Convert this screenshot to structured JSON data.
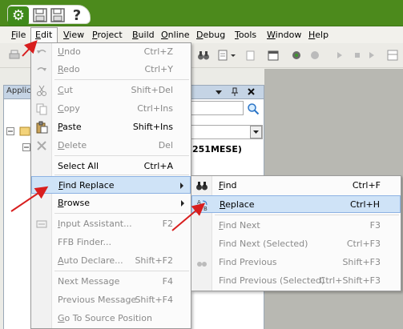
{
  "title_bar": {
    "help_glyph": "?"
  },
  "menubar": {
    "items": [
      {
        "label_pre": "",
        "acc": "F",
        "label_post": "ile"
      },
      {
        "label_pre": "",
        "acc": "E",
        "label_post": "dit"
      },
      {
        "label_pre": "",
        "acc": "V",
        "label_post": "iew"
      },
      {
        "label_pre": "",
        "acc": "P",
        "label_post": "roject"
      },
      {
        "label_pre": "",
        "acc": "B",
        "label_post": "uild"
      },
      {
        "label_pre": "",
        "acc": "O",
        "label_post": "nline"
      },
      {
        "label_pre": "",
        "acc": "D",
        "label_post": "ebug"
      },
      {
        "label_pre": "",
        "acc": "T",
        "label_post": "ools"
      },
      {
        "label_pre": "",
        "acc": "W",
        "label_post": "indow"
      },
      {
        "label_pre": "",
        "acc": "H",
        "label_post": "elp"
      }
    ]
  },
  "panel": {
    "title": "Applica",
    "device_text": "251MESE)"
  },
  "edit_menu": {
    "undo": {
      "acc": "U",
      "rest": "ndo",
      "shortcut": "Ctrl+Z"
    },
    "redo": {
      "acc": "R",
      "rest": "edo",
      "shortcut": "Ctrl+Y"
    },
    "cut": {
      "acc": "C",
      "rest": "ut",
      "shortcut": "Shift+Del"
    },
    "copy": {
      "acc": "C",
      "rest": "opy",
      "shortcut": "Ctrl+Ins"
    },
    "paste": {
      "acc": "P",
      "rest": "aste",
      "shortcut": "Shift+Ins"
    },
    "delete": {
      "acc": "D",
      "rest": "elete",
      "shortcut": "Del"
    },
    "select_all": {
      "label": "Select All",
      "shortcut": "Ctrl+A"
    },
    "find_replace": {
      "acc": "F",
      "rest": "ind Replace"
    },
    "browse": {
      "acc": "B",
      "rest": "rowse"
    },
    "input_assistant": {
      "acc": "I",
      "rest": "nput Assistant...",
      "shortcut": "F2"
    },
    "ffb_finder": {
      "label": "FFB Finder..."
    },
    "auto_declare": {
      "acc": "A",
      "rest": "uto Declare...",
      "shortcut": "Shift+F2"
    },
    "next_message": {
      "label": "Next Message",
      "shortcut": "F4"
    },
    "previous_message": {
      "label": "Previous Message",
      "shortcut": "Shift+F4"
    },
    "go_to_source": {
      "acc": "G",
      "rest": "o To Source Position"
    }
  },
  "find_submenu": {
    "find": {
      "acc": "F",
      "rest": "ind",
      "shortcut": "Ctrl+F"
    },
    "replace": {
      "acc": "R",
      "rest": "eplace",
      "shortcut": "Ctrl+H"
    },
    "find_next": {
      "acc": "F",
      "rest": "ind Next",
      "shortcut": "F3"
    },
    "find_next_selected": {
      "label": "Find Next (Selected)",
      "shortcut": "Ctrl+F3"
    },
    "find_previous": {
      "label": "Find Previous",
      "shortcut": "Shift+F3"
    },
    "find_previous_selected": {
      "label": "Find Previous (Selected)",
      "shortcut": "Ctrl+Shift+F3"
    }
  },
  "colors": {
    "title_bar": "#4c8a1c",
    "highlight": "#cfe3f7",
    "highlight_border": "#8db2e3",
    "annotation_arrow": "#d81e1e",
    "disabled_text": "#8a8a8a"
  }
}
